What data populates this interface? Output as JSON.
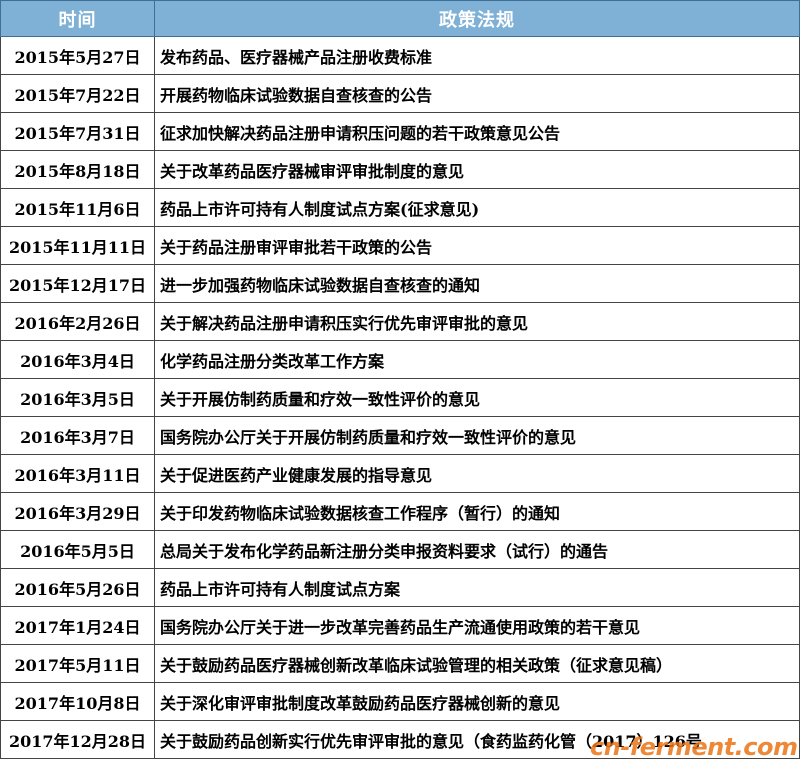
{
  "table": {
    "headers": {
      "date": "时间",
      "policy": "政策法规"
    },
    "rows": [
      {
        "date": "2015年5月27日",
        "policy": "发布药品、医疗器械产品注册收费标准"
      },
      {
        "date": "2015年7月22日",
        "policy": "开展药物临床试验数据自查核查的公告"
      },
      {
        "date": "2015年7月31日",
        "policy": "征求加快解决药品注册申请积压问题的若干政策意见公告"
      },
      {
        "date": "2015年8月18日",
        "policy": "关于改革药品医疗器械审评审批制度的意见"
      },
      {
        "date": "2015年11月6日",
        "policy": "药品上市许可持有人制度试点方案(征求意见)"
      },
      {
        "date": "2015年11月11日",
        "policy": "关于药品注册审评审批若干政策的公告"
      },
      {
        "date": "2015年12月17日",
        "policy": "进一步加强药物临床试验数据自查核查的通知"
      },
      {
        "date": "2016年2月26日",
        "policy": "关于解决药品注册申请积压实行优先审评审批的意见"
      },
      {
        "date": "2016年3月4日",
        "policy": "化学药品注册分类改革工作方案"
      },
      {
        "date": "2016年3月5日",
        "policy": "关于开展仿制药质量和疗效一致性评价的意见"
      },
      {
        "date": "2016年3月7日",
        "policy": "国务院办公厅关于开展仿制药质量和疗效一致性评价的意见"
      },
      {
        "date": "2016年3月11日",
        "policy": "关于促进医药产业健康发展的指导意见"
      },
      {
        "date": "2016年3月29日",
        "policy": "关于印发药物临床试验数据核查工作程序（暂行）的通知"
      },
      {
        "date": "2016年5月5日",
        "policy": "总局关于发布化学药品新注册分类申报资料要求（试行）的通告"
      },
      {
        "date": "2016年5月26日",
        "policy": "药品上市许可持有人制度试点方案"
      },
      {
        "date": "2017年1月24日",
        "policy": "国务院办公厅关于进一步改革完善药品生产流通使用政策的若干意见"
      },
      {
        "date": "2017年5月11日",
        "policy": "关于鼓励药品医疗器械创新改革临床试验管理的相关政策（征求意见稿）"
      },
      {
        "date": "2017年10月8日",
        "policy": "关于深化审评审批制度改革鼓励药品医疗器械创新的意见"
      },
      {
        "date": "2017年12月28日",
        "policy": "关于鼓励药品创新实行优先审评审批的意见（食药监药化管（2017）126号"
      }
    ]
  },
  "watermark": "cn-ferment.com"
}
